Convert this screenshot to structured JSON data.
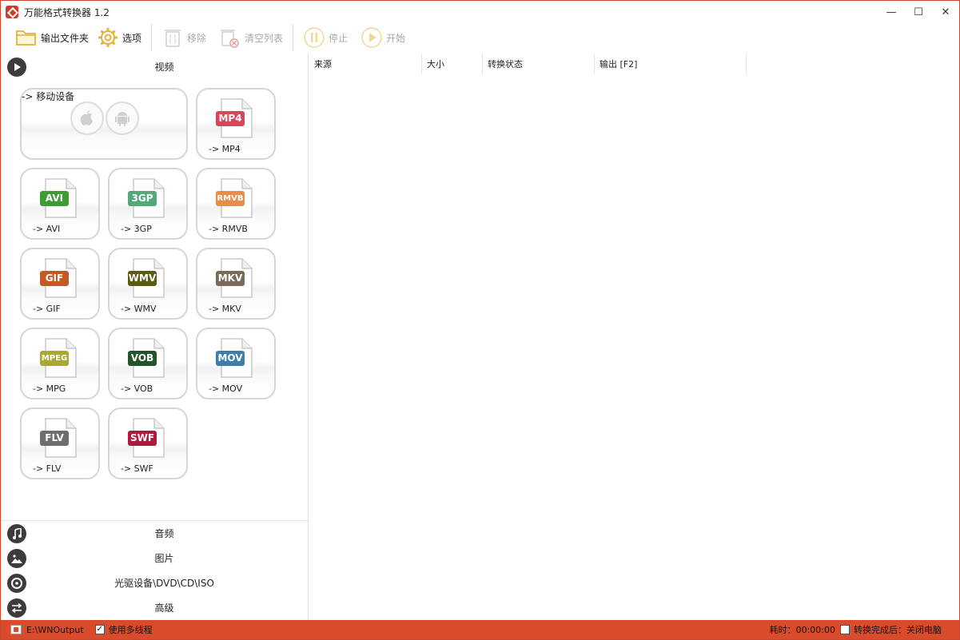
{
  "window": {
    "title": "万能格式转换器 1.2",
    "controls": {
      "minimize": "—",
      "maximize": "☐",
      "close": "✕"
    }
  },
  "toolbar": {
    "output_folder": "输出文件夹",
    "options": "选项",
    "remove": "移除",
    "clear_list": "清空列表",
    "stop": "停止",
    "start": "开始"
  },
  "categories": {
    "video": "视频",
    "audio": "音频",
    "image": "图片",
    "disc": "光驱设备\\DVD\\CD\\ISO",
    "advanced": "高级"
  },
  "formats": {
    "mobile": {
      "label": "-> 移动设备"
    },
    "mp4": {
      "badge": "MP4",
      "label": "-> MP4",
      "color": "#d9455a"
    },
    "avi": {
      "badge": "AVI",
      "label": "-> AVI",
      "color": "#3f9b35"
    },
    "3gp": {
      "badge": "3GP",
      "label": "-> 3GP",
      "color": "#55a87a"
    },
    "rmvb": {
      "badge": "RMVB",
      "label": "-> RMVB",
      "color": "#e98c47"
    },
    "gif": {
      "badge": "GIF",
      "label": "-> GIF",
      "color": "#c25a26"
    },
    "wmv": {
      "badge": "WMV",
      "label": "-> WMV",
      "color": "#5a5a12"
    },
    "mkv": {
      "badge": "MKV",
      "label": "-> MKV",
      "color": "#7a6a58"
    },
    "mpg": {
      "badge": "MPEG",
      "label": "-> MPG",
      "color": "#a9a832"
    },
    "vob": {
      "badge": "VOB",
      "label": "-> VOB",
      "color": "#23542a"
    },
    "mov": {
      "badge": "MOV",
      "label": "-> MOV",
      "color": "#3d7fa8"
    },
    "flv": {
      "badge": "FLV",
      "label": "-> FLV",
      "color": "#6e6e6e"
    },
    "swf": {
      "badge": "SWF",
      "label": "-> SWF",
      "color": "#b0193a"
    }
  },
  "list": {
    "columns": [
      "来源",
      "大小",
      "转换状态",
      "输出 [F2]"
    ]
  },
  "statusbar": {
    "output_path": "E:\\WNOutput",
    "multithread_label": "使用多线程",
    "multithread_checked": true,
    "elapsed": "耗时：00:00:00",
    "shutdown_label": "转换完成后：关闭电脑",
    "shutdown_checked": false
  },
  "colors": {
    "accent": "#d94b2b",
    "toolbar_disabled": "#a9a9a9",
    "toolbar_icon": "#e0b43a"
  }
}
